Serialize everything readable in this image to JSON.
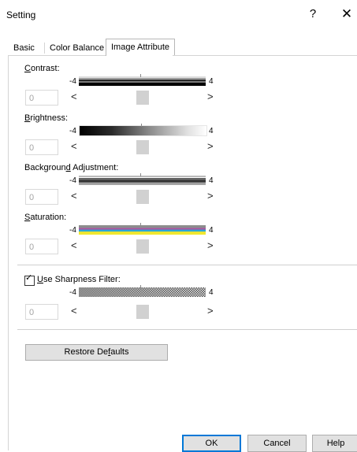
{
  "window": {
    "title": "Setting",
    "help_glyph": "?",
    "close_glyph": "✕"
  },
  "tabs": [
    {
      "label": "Basic"
    },
    {
      "label": "Color Balance"
    },
    {
      "label": "Image Attribute",
      "active": true
    }
  ],
  "sliders": [
    {
      "key": "contrast",
      "label_first": "C",
      "label_rest": "ontrast:",
      "min": "-4",
      "max": "4",
      "value": "0",
      "level": 0
    },
    {
      "key": "brightness",
      "label_first": "B",
      "label_rest": "rightness:",
      "min": "-4",
      "max": "4",
      "value": "0",
      "level": 0
    },
    {
      "key": "background",
      "label_pre": "Backgroun",
      "label_under": "d",
      "label_post": " Adjustment:",
      "min": "-4",
      "max": "4",
      "value": "0",
      "level": 0
    },
    {
      "key": "saturation",
      "label_first": "S",
      "label_rest": "aturation:",
      "min": "-4",
      "max": "4",
      "value": "0",
      "level": 0
    },
    {
      "key": "sharpness",
      "label_first": "U",
      "label_rest": "se Sharpness Filter:",
      "min": "-4",
      "max": "4",
      "value": "0",
      "level": 0,
      "checked": true
    }
  ],
  "arrows": {
    "left": "<",
    "right": ">"
  },
  "restore": {
    "pre": "Restore De",
    "under": "f",
    "post": "aults"
  },
  "footer": {
    "ok": "OK",
    "cancel": "Cancel",
    "help": "Help"
  },
  "colors": {
    "accent": "#0078d7",
    "button_bg": "#e1e1e1",
    "thumb": "#d1d1d1"
  }
}
